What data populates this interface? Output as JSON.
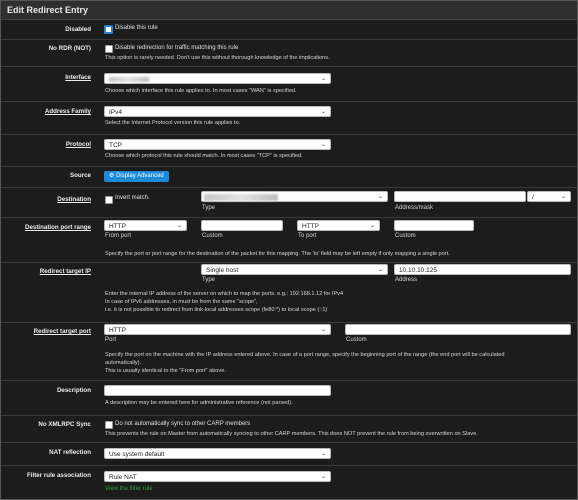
{
  "header": {
    "title": "Edit Redirect Entry"
  },
  "disabled": {
    "label": "Disabled",
    "checkbox_text": "Disable this rule"
  },
  "no_rdr": {
    "label": "No RDR (NOT)",
    "checkbox_text": "Disable redirection for traffic matching this rule",
    "help": "This option is rarely needed. Don't use this without thorough knowledge of the implications."
  },
  "interface": {
    "label": "Interface",
    "help": "Choose which interface this rule applies to. In most cases \"WAN\" is specified."
  },
  "address_family": {
    "label": "Address Family",
    "value": "IPv4",
    "help": "Select the Internet Protocol version this rule applies to."
  },
  "protocol": {
    "label": "Protocol",
    "value": "TCP",
    "help": "Choose which protocol this rule should match. In most cases \"TCP\" is specified."
  },
  "source": {
    "label": "Source",
    "button": "Display Advanced",
    "button_icon": "gear-icon"
  },
  "destination": {
    "label": "Destination",
    "invert_text": "Invert match.",
    "type_caption": "Type",
    "addr_caption": "Address/mask",
    "slash": "/"
  },
  "dest_port_range": {
    "label": "Destination port range",
    "from_value": "HTTP",
    "from_caption": "From port",
    "custom_caption1": "Custom",
    "to_value": "HTTP",
    "to_caption": "To port",
    "custom_caption2": "Custom",
    "help": "Specify the port or port range for the destination of the packet for this mapping. The 'to' field may be left empty if only mapping a single port."
  },
  "redirect_ip": {
    "label": "Redirect target IP",
    "type_value": "Single host",
    "type_caption": "Type",
    "address_value": "10.10.10.125",
    "address_caption": "Address",
    "help1": "Enter the internal IP address of the server on which to map the ports. e.g.: 192.168.1.12 for IPv4",
    "help2": "In case of IPv6 addresses, in must be from the same \"scope\",",
    "help3": "i.e. it is not possible to redirect from link-local addresses scope (fe80:*) to local scope (::1)"
  },
  "redirect_port": {
    "label": "Redirect target port",
    "port_value": "HTTP",
    "port_caption": "Port",
    "custom_caption": "Custom",
    "help1": "Specify the port on the machine with the IP address entered above. In case of a port range, specify the beginning port of the range (the end port will be calculated",
    "help2": "automatically).",
    "help3": "This is usually identical to the \"From port\" above."
  },
  "description": {
    "label": "Description",
    "help": "A description may be entered here for administrative reference (not parsed)."
  },
  "xmlrpc": {
    "label": "No XMLRPC Sync",
    "checkbox_text": "Do not automatically sync to other CARP members",
    "help": "This prevents the rule on Master from automatically syncing to other CARP members. This does NOT prevent the rule from being overwritten on Slave."
  },
  "nat_reflection": {
    "label": "NAT reflection",
    "value": "Use system default"
  },
  "filter_assoc": {
    "label": "Filter rule association",
    "value": "Rule NAT",
    "link": "View the filter rule"
  }
}
